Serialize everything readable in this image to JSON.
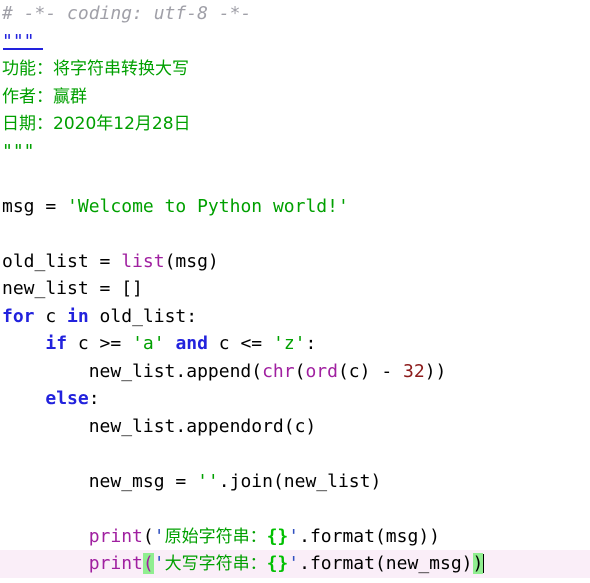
{
  "editor": {
    "language": "Python",
    "theme": {
      "background": "#ffffff",
      "foreground": "#000000",
      "comment": "#a0a0a8",
      "keyword": "#2222dd",
      "builtin": "#a020a0",
      "string": "#00a000",
      "number": "#8b1a1a",
      "current_line_highlight": "#faeef8",
      "bracket_match_highlight": "#90ee90",
      "annotation_underline": "#2222dd"
    },
    "current_line_number": 18,
    "caret_visible": true
  },
  "code": {
    "lines": [
      {
        "n": 1,
        "tokens": [
          {
            "t": "# -*- coding: utf-8 -*-",
            "c": "comment"
          }
        ]
      },
      {
        "n": 2,
        "tokens": [
          {
            "t": "\"\"\"",
            "c": "docq-blue"
          }
        ],
        "underline_annotation": true
      },
      {
        "n": 3,
        "tokens": [
          {
            "t": "功能：将字符串转换大写",
            "c": "doc",
            "cjk": true
          }
        ]
      },
      {
        "n": 4,
        "tokens": [
          {
            "t": "作者：赢群",
            "c": "doc",
            "cjk": true
          }
        ]
      },
      {
        "n": 5,
        "tokens": [
          {
            "t": "日期：2020年12月28日",
            "c": "doc",
            "cjk": true
          }
        ]
      },
      {
        "n": 6,
        "tokens": [
          {
            "t": "\"\"\"",
            "c": "doc"
          }
        ]
      },
      {
        "n": 7,
        "tokens": []
      },
      {
        "n": 8,
        "tokens": [
          {
            "t": "msg ",
            "c": "plain"
          },
          {
            "t": "= ",
            "c": "plain"
          },
          {
            "t": "'Welcome to Python world!'",
            "c": "string"
          }
        ]
      },
      {
        "n": 9,
        "tokens": []
      },
      {
        "n": 10,
        "tokens": [
          {
            "t": "old_list = ",
            "c": "plain"
          },
          {
            "t": "list",
            "c": "builtin"
          },
          {
            "t": "(msg)",
            "c": "plain"
          }
        ]
      },
      {
        "n": 11,
        "tokens": [
          {
            "t": "new_list = []",
            "c": "plain"
          }
        ]
      },
      {
        "n": 12,
        "tokens": [
          {
            "t": "for",
            "c": "keyword"
          },
          {
            "t": " c ",
            "c": "plain"
          },
          {
            "t": "in",
            "c": "keyword"
          },
          {
            "t": " old_list:",
            "c": "plain"
          }
        ]
      },
      {
        "n": 13,
        "tokens": [
          {
            "t": "    ",
            "c": "plain"
          },
          {
            "t": "if",
            "c": "keyword"
          },
          {
            "t": " c >= ",
            "c": "plain"
          },
          {
            "t": "'a'",
            "c": "string"
          },
          {
            "t": " ",
            "c": "plain"
          },
          {
            "t": "and",
            "c": "keyword"
          },
          {
            "t": " c <= ",
            "c": "plain"
          },
          {
            "t": "'z'",
            "c": "string"
          },
          {
            "t": ":",
            "c": "plain"
          }
        ]
      },
      {
        "n": 14,
        "tokens": [
          {
            "t": "        new_list.append(",
            "c": "plain"
          },
          {
            "t": "chr",
            "c": "builtin"
          },
          {
            "t": "(",
            "c": "plain"
          },
          {
            "t": "ord",
            "c": "builtin"
          },
          {
            "t": "(c) - ",
            "c": "plain"
          },
          {
            "t": "32",
            "c": "number"
          },
          {
            "t": "))",
            "c": "plain"
          }
        ]
      },
      {
        "n": 15,
        "tokens": [
          {
            "t": "    ",
            "c": "plain"
          },
          {
            "t": "else",
            "c": "keyword"
          },
          {
            "t": ":",
            "c": "plain"
          }
        ]
      },
      {
        "n": 16,
        "tokens": [
          {
            "t": "        new_list.appendord(c)",
            "c": "plain"
          }
        ]
      },
      {
        "n": 17,
        "tokens": []
      },
      {
        "n": 18,
        "tokens": [
          {
            "t": "        new_msg = ",
            "c": "plain"
          },
          {
            "t": "''",
            "c": "string"
          },
          {
            "t": ".join(new_list)",
            "c": "plain"
          }
        ]
      },
      {
        "n": 19,
        "tokens": []
      },
      {
        "n": 20,
        "tokens": [
          {
            "t": "        ",
            "c": "plain"
          },
          {
            "t": "print",
            "c": "builtin"
          },
          {
            "t": "(",
            "c": "plain"
          },
          {
            "t": "'",
            "c": "quote"
          },
          {
            "t": "原始字符串：",
            "c": "string",
            "cjk": true
          },
          {
            "t": "{}",
            "c": "fmt"
          },
          {
            "t": "'",
            "c": "quote"
          },
          {
            "t": ".format(msg))",
            "c": "plain"
          }
        ]
      },
      {
        "n": 21,
        "current": true,
        "tokens": [
          {
            "t": "        ",
            "c": "plain"
          },
          {
            "t": "print",
            "c": "builtin"
          },
          {
            "t": "(",
            "c": "bracket-open"
          },
          {
            "t": "'",
            "c": "quote"
          },
          {
            "t": "大写字符串：",
            "c": "string",
            "cjk": true
          },
          {
            "t": "{}",
            "c": "fmt"
          },
          {
            "t": "'",
            "c": "quote"
          },
          {
            "t": ".format(new_msg)",
            "c": "plain"
          },
          {
            "t": ")",
            "c": "bracket-close"
          }
        ],
        "caret_after": true
      }
    ]
  }
}
